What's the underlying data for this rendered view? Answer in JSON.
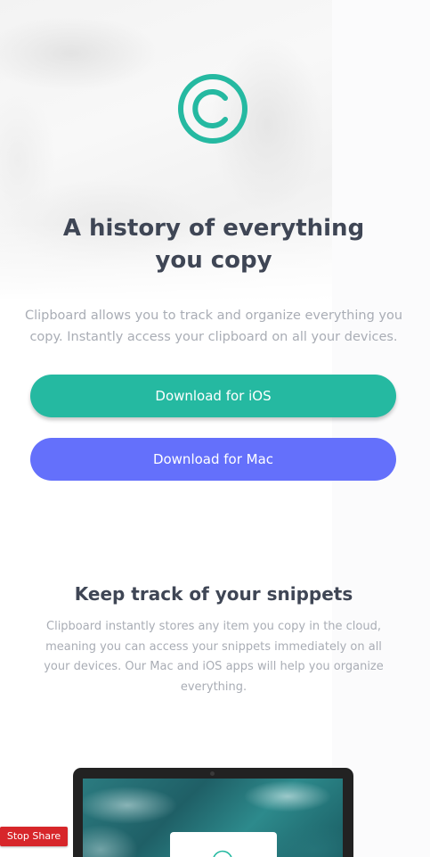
{
  "colors": {
    "accent_green": "#25b9a1",
    "accent_blue": "#6470fb",
    "heading": "#3f4655",
    "body_text": "#a9adb5",
    "stop_share_red": "#d7262a"
  },
  "hero": {
    "logo_icon": "copyright-circle-icon",
    "title": "A history of everything you copy",
    "description": "Clipboard allows you to track and organize everything you copy. Instantly access your clipboard on all your devices."
  },
  "buttons": {
    "ios_label": "Download for iOS",
    "mac_label": "Download for Mac"
  },
  "snippets": {
    "title": "Keep track of your snippets",
    "description": "Clipboard instantly stores any item you copy in the cloud, meaning you can access your snippets immediately on all your devices. Our Mac and iOS apps will help you organize everything."
  },
  "laptop": {
    "check_icon": "check-circle-icon"
  },
  "screen_share": {
    "stop_label": "Stop Share"
  }
}
